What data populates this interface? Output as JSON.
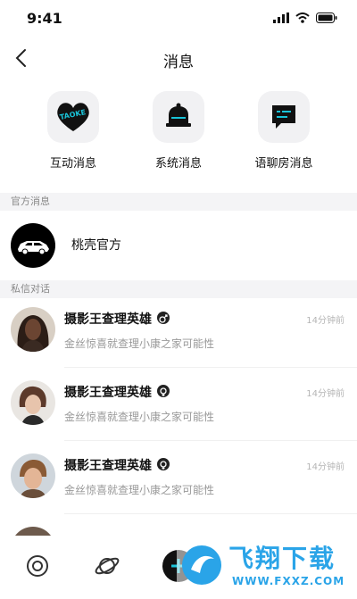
{
  "status_bar": {
    "time": "9:41",
    "icons": [
      "signal-icon",
      "wifi-icon",
      "battery-icon"
    ]
  },
  "nav": {
    "title": "消息",
    "back_icon": "chevron-left-icon"
  },
  "quick_actions": [
    {
      "label": "互动消息",
      "icon": "heart-icon",
      "icon_text": "TAOKE"
    },
    {
      "label": "系统消息",
      "icon": "bell-icon"
    },
    {
      "label": "语聊房消息",
      "icon": "chat-bubble-icon"
    }
  ],
  "sections": {
    "official_label": "官方消息",
    "private_label": "私信对话"
  },
  "official": {
    "name": "桃壳官方",
    "avatar_icon": "car-logo-icon"
  },
  "conversations": [
    {
      "name": "摄影王查理英雄",
      "time": "14分钟前",
      "message": "金丝惊喜就查理小康之家可能性",
      "badge_icon": "male-badge-icon"
    },
    {
      "name": "摄影王查理英雄",
      "time": "14分钟前",
      "message": "金丝惊喜就查理小康之家可能性",
      "badge_icon": "female-badge-icon"
    },
    {
      "name": "摄影王查理英雄",
      "time": "14分钟前",
      "message": "金丝惊喜就查理小康之家可能性",
      "badge_icon": "female-badge-icon"
    }
  ],
  "tabbar": {
    "icons": [
      "home-icon",
      "planet-icon",
      "add-icon"
    ]
  },
  "watermark": {
    "text": "飞翔下载",
    "url": "WWW.FXXZ.COM"
  },
  "colors": {
    "accent": "#19c3d8",
    "badge": "#222222",
    "section_bg": "#f4f4f6"
  }
}
